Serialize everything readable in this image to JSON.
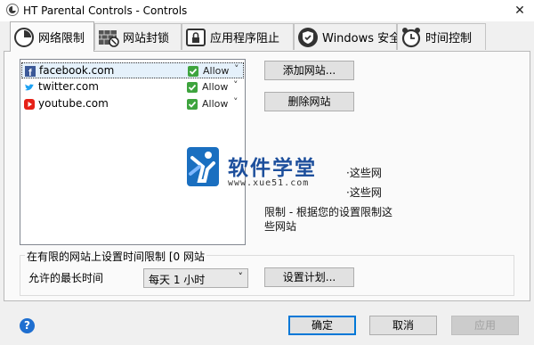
{
  "window": {
    "title": "HT Parental Controls - Controls",
    "close_glyph": "✕"
  },
  "tabs": [
    {
      "label": "网络限制",
      "icon": "clock-icon",
      "active": true
    },
    {
      "label": "网站封锁",
      "icon": "blocked-wall-icon",
      "active": false
    },
    {
      "label": "应用程序阻止",
      "icon": "lock-icon",
      "active": false
    },
    {
      "label": "Windows 安全",
      "icon": "shield-check-icon",
      "active": false
    },
    {
      "label": "时间控制",
      "icon": "alarm-clock-icon",
      "active": false
    }
  ],
  "sites": [
    {
      "name": "facebook.com",
      "icon": "facebook-icon",
      "status": "Allow",
      "selected": true
    },
    {
      "name": "twitter.com",
      "icon": "twitter-icon",
      "status": "Allow",
      "selected": false
    },
    {
      "name": "youtube.com",
      "icon": "youtube-icon",
      "status": "Allow",
      "selected": false
    }
  ],
  "chevron_glyph": "˅",
  "actions": {
    "add_site": "添加网站...",
    "remove_site": "删除网站"
  },
  "info_lines": [
    "·这些网",
    "·这些网",
    "限制 - 根据您的设置限制这",
    "些网站"
  ],
  "watermark": {
    "title": "软件学堂",
    "url": "www.xue51.com"
  },
  "time_limit": {
    "legend": "在有限的网站上设置时间限制 [0 网站",
    "max_time_label": "允许的最长时间",
    "selected_value": "每天 1 小时",
    "schedule_button": "设置计划..."
  },
  "footer": {
    "help_glyph": "?",
    "ok": "确定",
    "cancel": "取消",
    "apply": "应用"
  },
  "colors": {
    "accent": "#0078d7",
    "allow_check": "#3ea43e",
    "watermark": "#1d4f9c",
    "facebook": "#3b5998",
    "twitter": "#1da1f2",
    "youtube": "#e62117"
  }
}
